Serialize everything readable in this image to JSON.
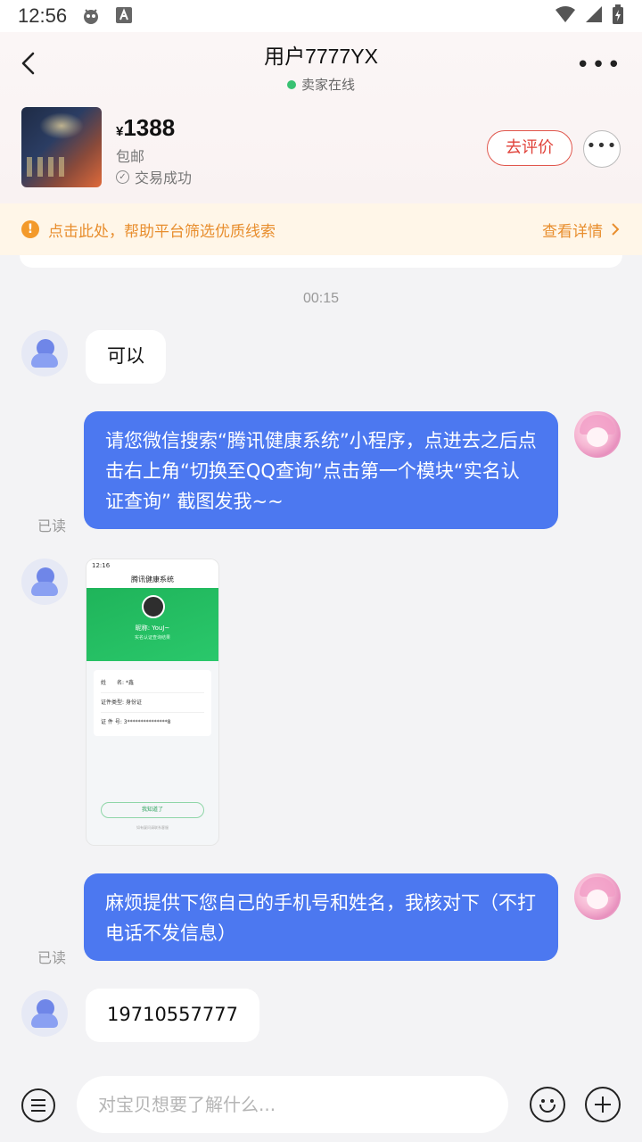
{
  "status_bar": {
    "time": "12:56"
  },
  "header": {
    "title": "用户7777YX",
    "online_text": "卖家在线"
  },
  "product": {
    "currency": "¥",
    "price": "1388",
    "shipping": "包邮",
    "status": "交易成功",
    "rate_label": "去评价"
  },
  "notice": {
    "text": "点击此处，帮助平台筛选优质线索",
    "detail_label": "查看详情"
  },
  "chat": {
    "timestamp": "00:15",
    "messages": [
      {
        "side": "left",
        "text": "可以"
      },
      {
        "side": "right",
        "text": "请您微信搜索“腾讯健康系统”小程序，点进去之后点击右上角“切换至QQ查询”点击第一个模块“实名认证查询” 截图发我~~",
        "read": "已读"
      },
      {
        "side": "left",
        "type": "image",
        "screenshot": {
          "time": "12:16",
          "title": "腾讯健康系统",
          "nickname": "昵称: YouJ~",
          "desc": "实名认证查询结果",
          "rows": [
            {
              "label": "姓　　名:",
              "value": "*鑫"
            },
            {
              "label": "证件类型:",
              "value": "身份证"
            },
            {
              "label": "证 件 号:",
              "value": "3***************8"
            }
          ],
          "button": "我知道了",
          "footer": "如有疑问请联系客服"
        }
      },
      {
        "side": "right",
        "text": "麻烦提供下您自己的手机号和姓名，我核对下（不打电话不发信息）",
        "read": "已读"
      },
      {
        "side": "left",
        "text": "19710557777"
      }
    ]
  },
  "input": {
    "placeholder": "对宝贝想要了解什么..."
  }
}
